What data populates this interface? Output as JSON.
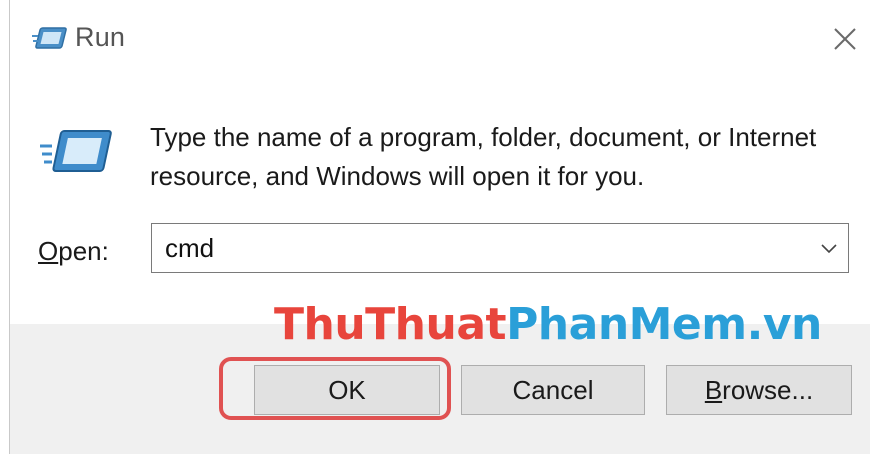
{
  "window": {
    "title": "Run",
    "title_icon": "run-icon",
    "close_icon": "close-icon"
  },
  "content": {
    "icon": "run-icon",
    "description": "Type the name of a program, folder, document, or Internet resource, and Windows will open it for you.",
    "open_label_accel": "O",
    "open_label_rest": "pen:",
    "command_value": "cmd",
    "dropdown_icon": "chevron-down-icon"
  },
  "buttons": {
    "ok": "OK",
    "cancel": "Cancel",
    "browse_accel": "B",
    "browse_rest": "rowse..."
  },
  "watermark": {
    "part1": "ThuThuat",
    "part2": "PhanMem.vn"
  },
  "colors": {
    "highlight": "#e05252",
    "watermark_red": "#e8453c",
    "watermark_blue": "#2a9fd8",
    "footer_bg": "#f0f0f0",
    "button_bg": "#e1e1e1"
  }
}
